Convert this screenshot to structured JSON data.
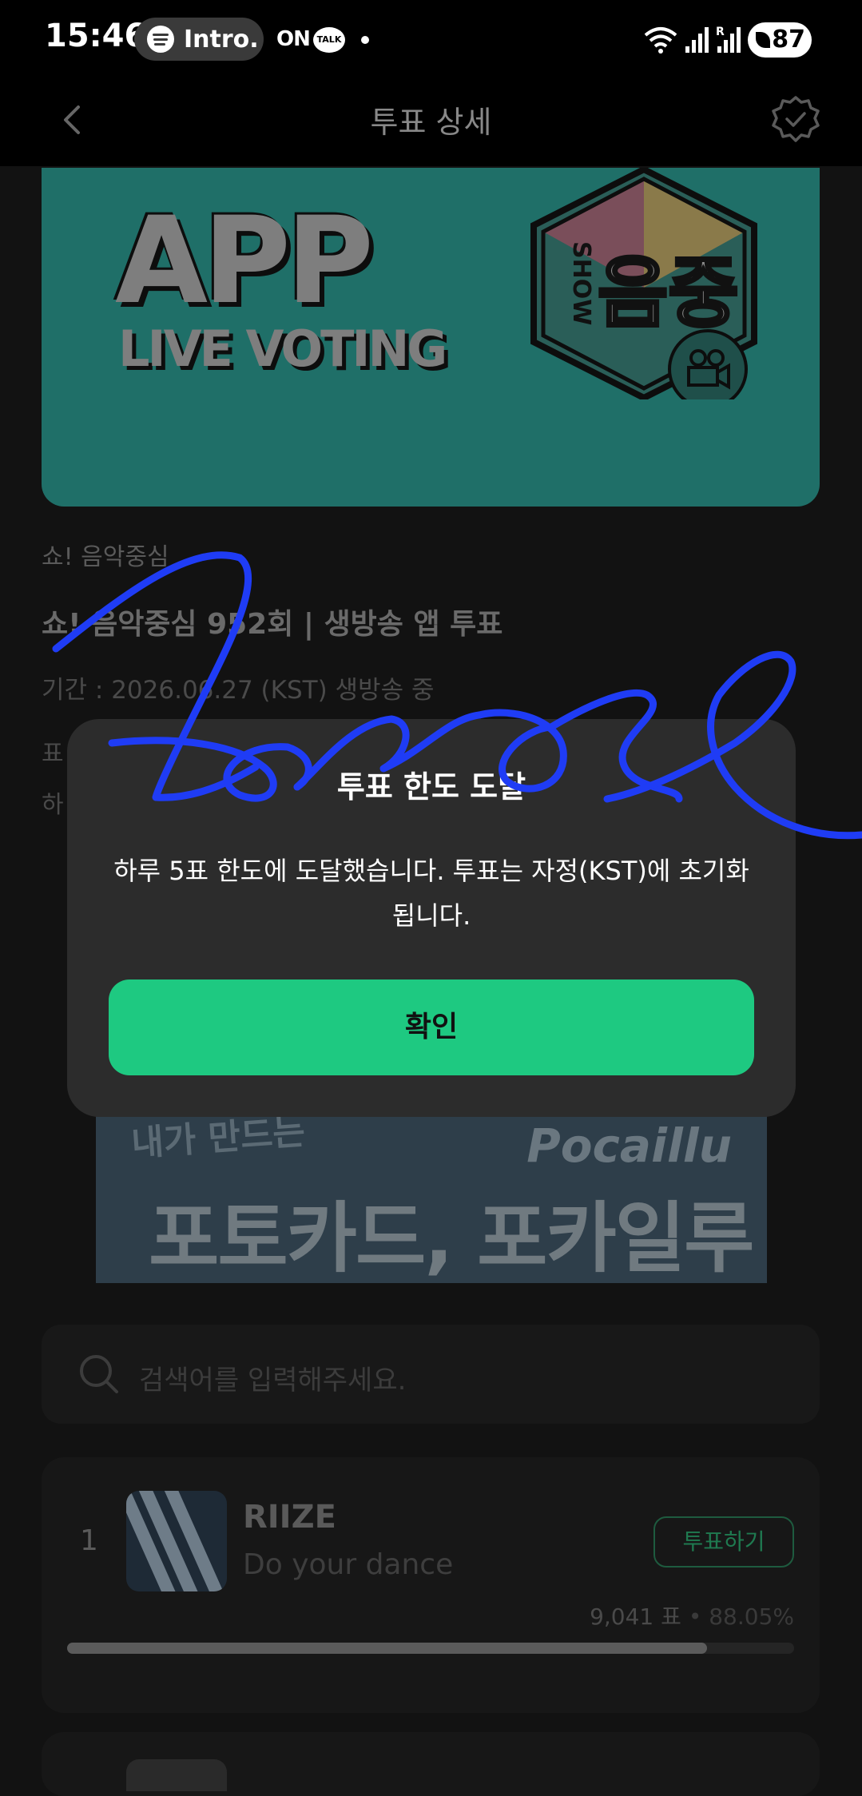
{
  "status_bar": {
    "time": "15:46",
    "media_app": "Intro.",
    "on_label": "ON",
    "talk_label": "TALK",
    "network_label": "R",
    "battery": "87"
  },
  "app_bar": {
    "title": "투표 상세"
  },
  "banner": {
    "headline": "APP",
    "subline": "LIVE VOTING",
    "logo_side": "SHOW",
    "logo_main": "음중"
  },
  "vote_info": {
    "category": "쇼! 음악중심",
    "title": "쇼! 음악중심 952회 | 생방송 앱 투표",
    "period": "기간 : 2026.06.27 (KST) 생방송 중",
    "desc_line1": "표",
    "desc_line2": "하"
  },
  "ad": {
    "small_text": "내가 만드는",
    "brand": "Pocaillu",
    "big_text": "포토카드, 포카일루"
  },
  "search": {
    "placeholder": "검색어를 입력해주세요."
  },
  "ranking": [
    {
      "rank": "1",
      "artist": "RIIZE",
      "song": "Do your dance",
      "vote_button": "투표하기",
      "votes": "9,041 표",
      "separator": "•",
      "percent": "88.05%",
      "progress": 0.8805
    }
  ],
  "dialog": {
    "title": "투표 한도 도달",
    "message": "하루 5표 한도에 도달했습니다. 투표는 자정(KST)에 초기화됩니다.",
    "confirm": "확인"
  },
  "colors": {
    "accent_green": "#1ec981",
    "banner_teal": "#1f6f68",
    "scribble_blue": "#1f3cf5"
  }
}
